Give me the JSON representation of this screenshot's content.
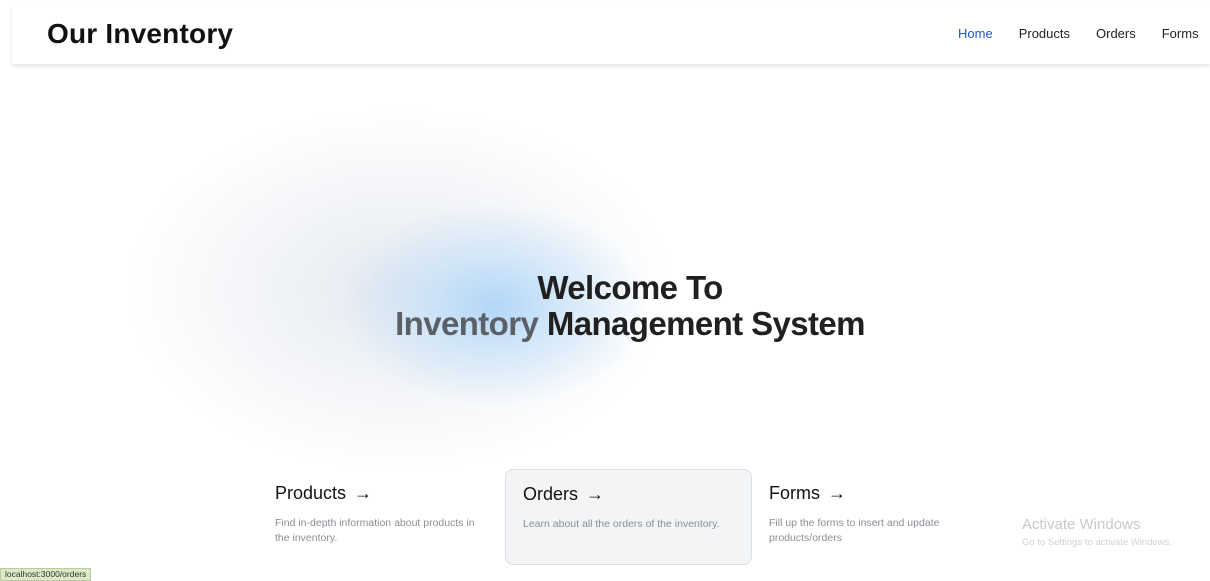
{
  "header": {
    "brand": "Our Inventory",
    "nav": [
      {
        "label": "Home",
        "active": true
      },
      {
        "label": "Products",
        "active": false
      },
      {
        "label": "Orders",
        "active": false
      },
      {
        "label": "Forms",
        "active": false
      }
    ]
  },
  "hero": {
    "line1": "Welcome To",
    "line2_part1": "Inventory",
    "line2_part2": "Management System"
  },
  "cards": [
    {
      "title": "Products",
      "arrow": "→",
      "description": "Find in-depth information about products in the inventory."
    },
    {
      "title": "Orders",
      "arrow": "→",
      "description": "Learn about all the orders of the inventory."
    },
    {
      "title": "Forms",
      "arrow": "→",
      "description": "Fill up the forms to insert and update products/orders"
    }
  ],
  "watermark": {
    "title": "Activate Windows",
    "subtitle": "Go to Settings to activate Windows."
  },
  "status_url": "localhost:3000/orders",
  "colors": {
    "nav_active": "#1f57c5",
    "glow_blue": "#a8d2f8",
    "status_bg": "#dbe9c6"
  }
}
